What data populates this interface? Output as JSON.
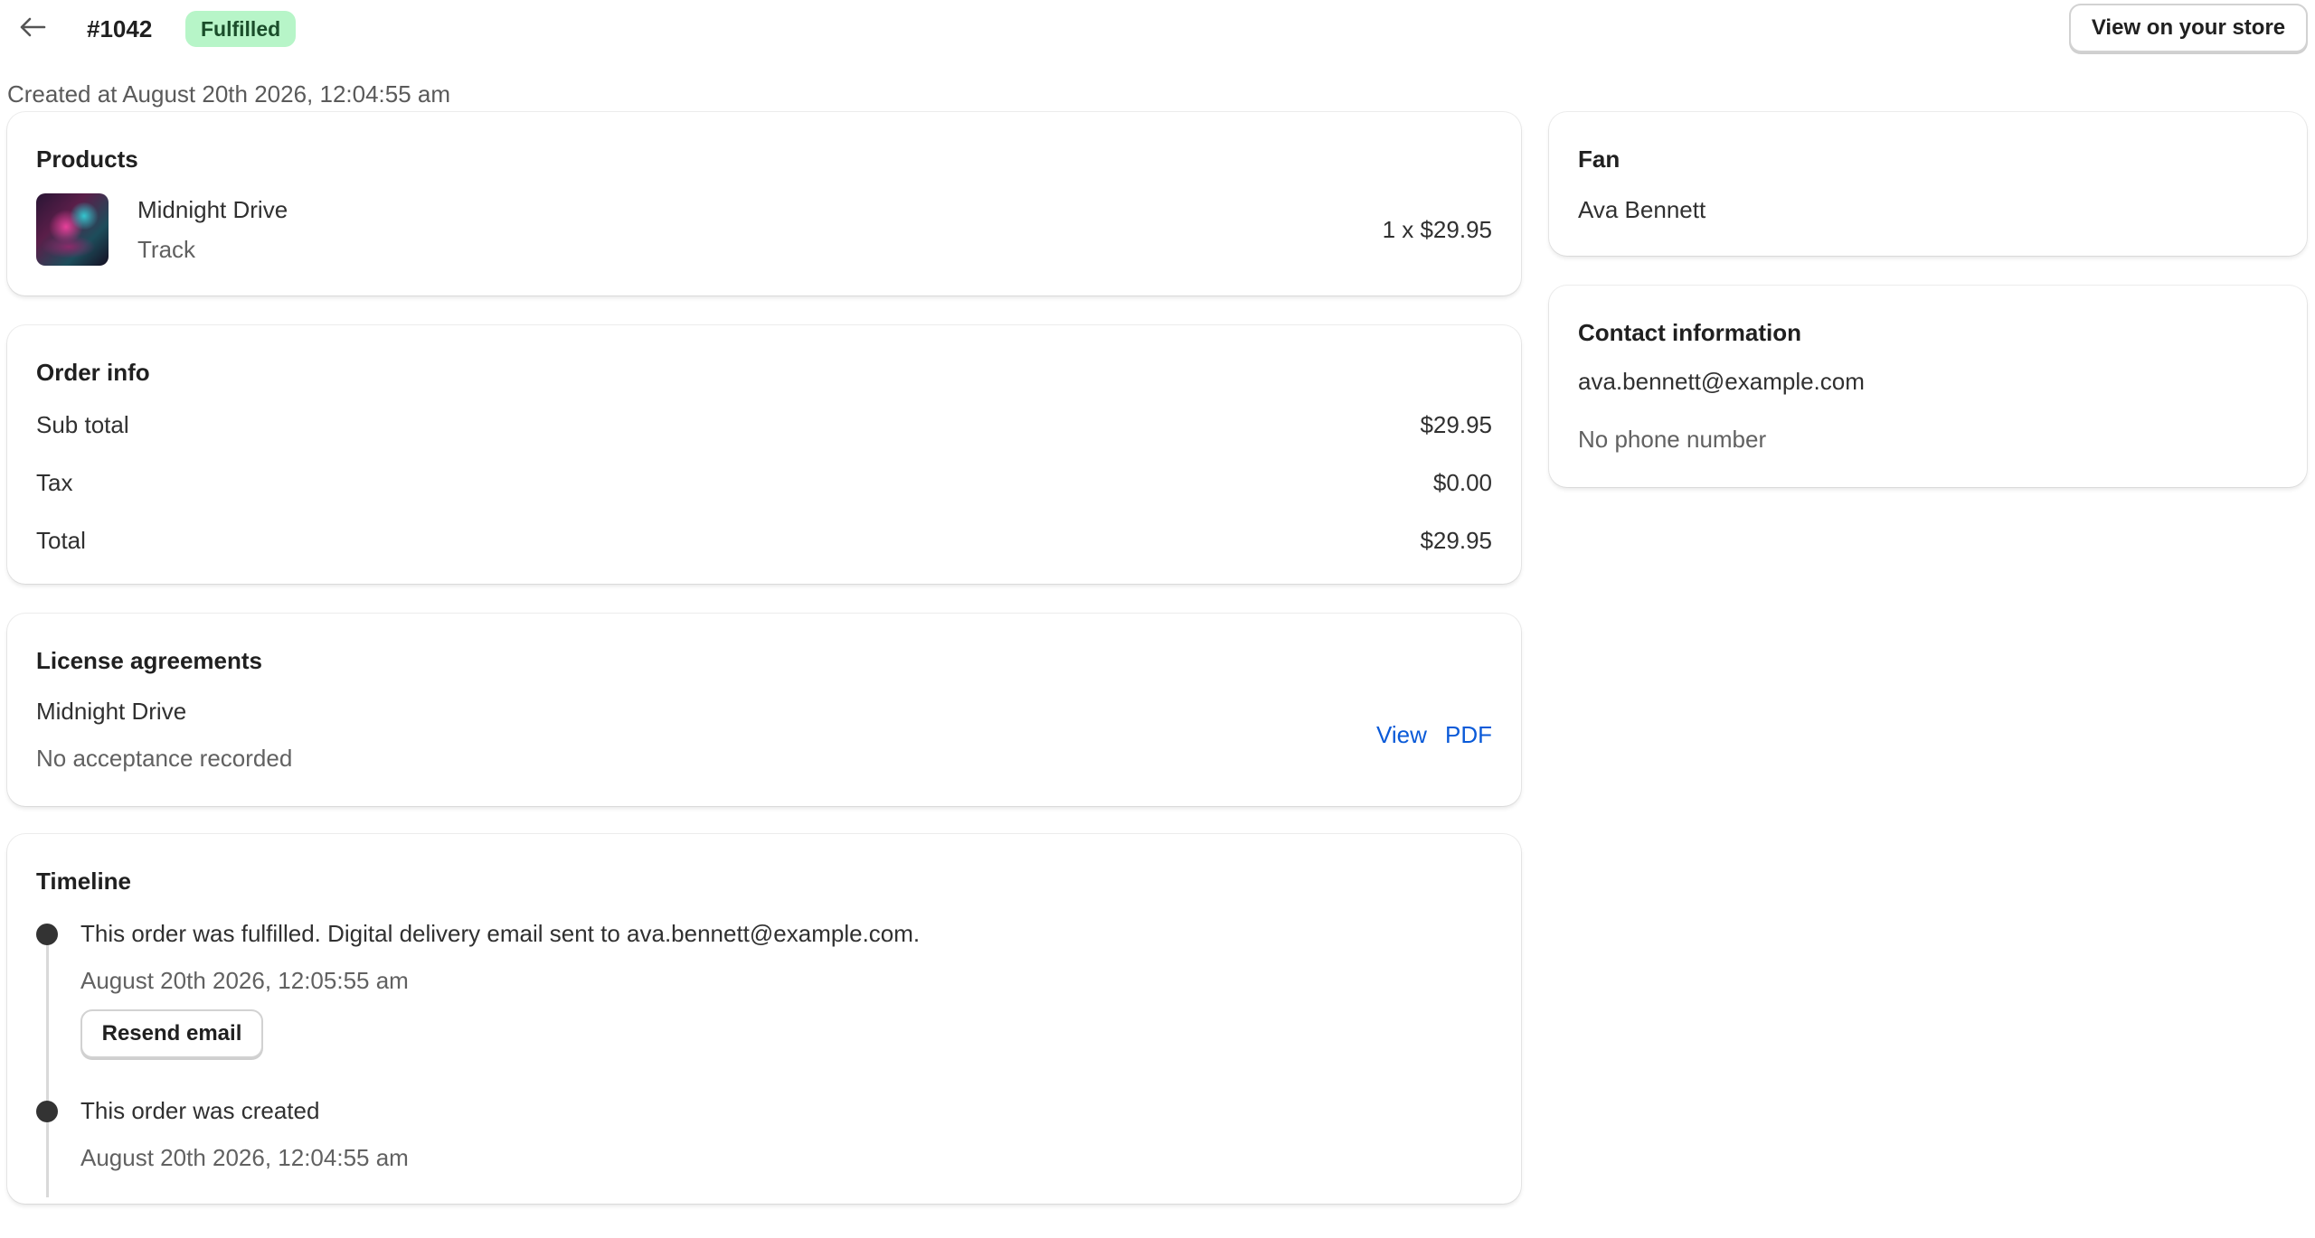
{
  "header": {
    "order_number": "#1042",
    "status_badge": "Fulfilled",
    "view_store_label": "View on your store"
  },
  "created_text": "Created at August 20th 2026, 12:04:55 am",
  "products": {
    "title": "Products",
    "item": {
      "name": "Midnight Drive",
      "type": "Track",
      "quantity_price": "1 x $29.95"
    }
  },
  "order_info": {
    "title": "Order info",
    "rows": [
      {
        "label": "Sub total",
        "value": "$29.95"
      },
      {
        "label": "Tax",
        "value": "$0.00"
      },
      {
        "label": "Total",
        "value": "$29.95"
      }
    ]
  },
  "license": {
    "title": "License agreements",
    "item_name": "Midnight Drive",
    "status": "No acceptance recorded",
    "view_link": "View",
    "pdf_link": "PDF"
  },
  "timeline": {
    "title": "Timeline",
    "events": [
      {
        "text": "This order was fulfilled. Digital delivery email sent to ava.bennett@example.com.",
        "time": "August 20th 2026, 12:05:55 am",
        "button": "Resend email"
      },
      {
        "text": "This order was created",
        "time": "August 20th 2026, 12:04:55 am"
      }
    ]
  },
  "fan": {
    "title": "Fan",
    "name": "Ava Bennett"
  },
  "contact": {
    "title": "Contact information",
    "email": "ava.bennett@example.com",
    "phone": "No phone number"
  },
  "colors": {
    "badge_bg": "#b7f5c8",
    "badge_text": "#1a4d2a",
    "link": "#0a5ad8"
  },
  "icons": {
    "back": "arrow-left-icon"
  }
}
